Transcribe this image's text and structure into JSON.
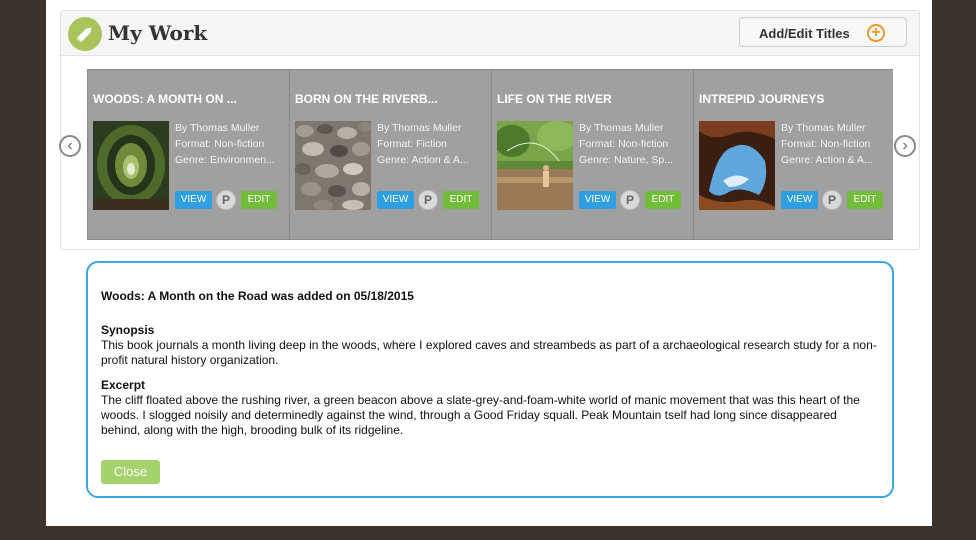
{
  "header": {
    "title": "My Work",
    "add_button_label": "Add/Edit Titles",
    "add_icon": "plus-circle-icon",
    "logo_icon": "pencil-icon"
  },
  "carousel": {
    "prev_icon": "chevron-left-icon",
    "next_icon": "chevron-right-icon",
    "cards": [
      {
        "title": "WOODS: A MONTH ON ...",
        "author": "By Thomas Muller",
        "format": "Format:  Non-fiction",
        "genre": "Genre:  Environmen...",
        "view": "VIEW",
        "p": "P",
        "edit": "EDIT"
      },
      {
        "title": "BORN ON THE RIVERB...",
        "author": "By Thomas Muller",
        "format": "Format:  Fiction",
        "genre": "Genre:  Action & A...",
        "view": "VIEW",
        "p": "P",
        "edit": "EDIT"
      },
      {
        "title": "LIFE ON THE RIVER",
        "author": "By Thomas Muller",
        "format": "Format:  Non-fiction",
        "genre": "Genre:  Nature, Sp...",
        "view": "VIEW",
        "p": "P",
        "edit": "EDIT"
      },
      {
        "title": "INTREPID JOURNEYS",
        "author": "By Thomas Muller",
        "format": "Format:  Non-fiction",
        "genre": "Genre:  Action & A...",
        "view": "VIEW",
        "p": "P",
        "edit": "EDIT"
      }
    ]
  },
  "detail": {
    "added_text": "Woods: A Month on the Road was added on 05/18/2015",
    "synopsis_heading": "Synopsis",
    "synopsis_text": "This book journals a month living deep in the woods, where I explored caves and streambeds as part of a archaeological research study for a non-profit natural history organization.",
    "excerpt_heading": "Excerpt",
    "excerpt_text": "The cliff floated above the rushing river, a green beacon above a slate-grey-and-foam-white world of manic movement that was this heart of the woods.  I slogged noisily and determinedly against the wind, through a Good Friday squall. Peak Mountain tself had long since disappeared behind, along with the high, brooding bulk of its ridgeline.",
    "close_label": "Close"
  },
  "colors": {
    "accent_blue": "#3aa6e5",
    "view_button": "#2f9fe3",
    "edit_button": "#72bd3a",
    "close_button": "#a4d26c",
    "add_icon": "#f0962a",
    "logo": "#a9c45a"
  }
}
